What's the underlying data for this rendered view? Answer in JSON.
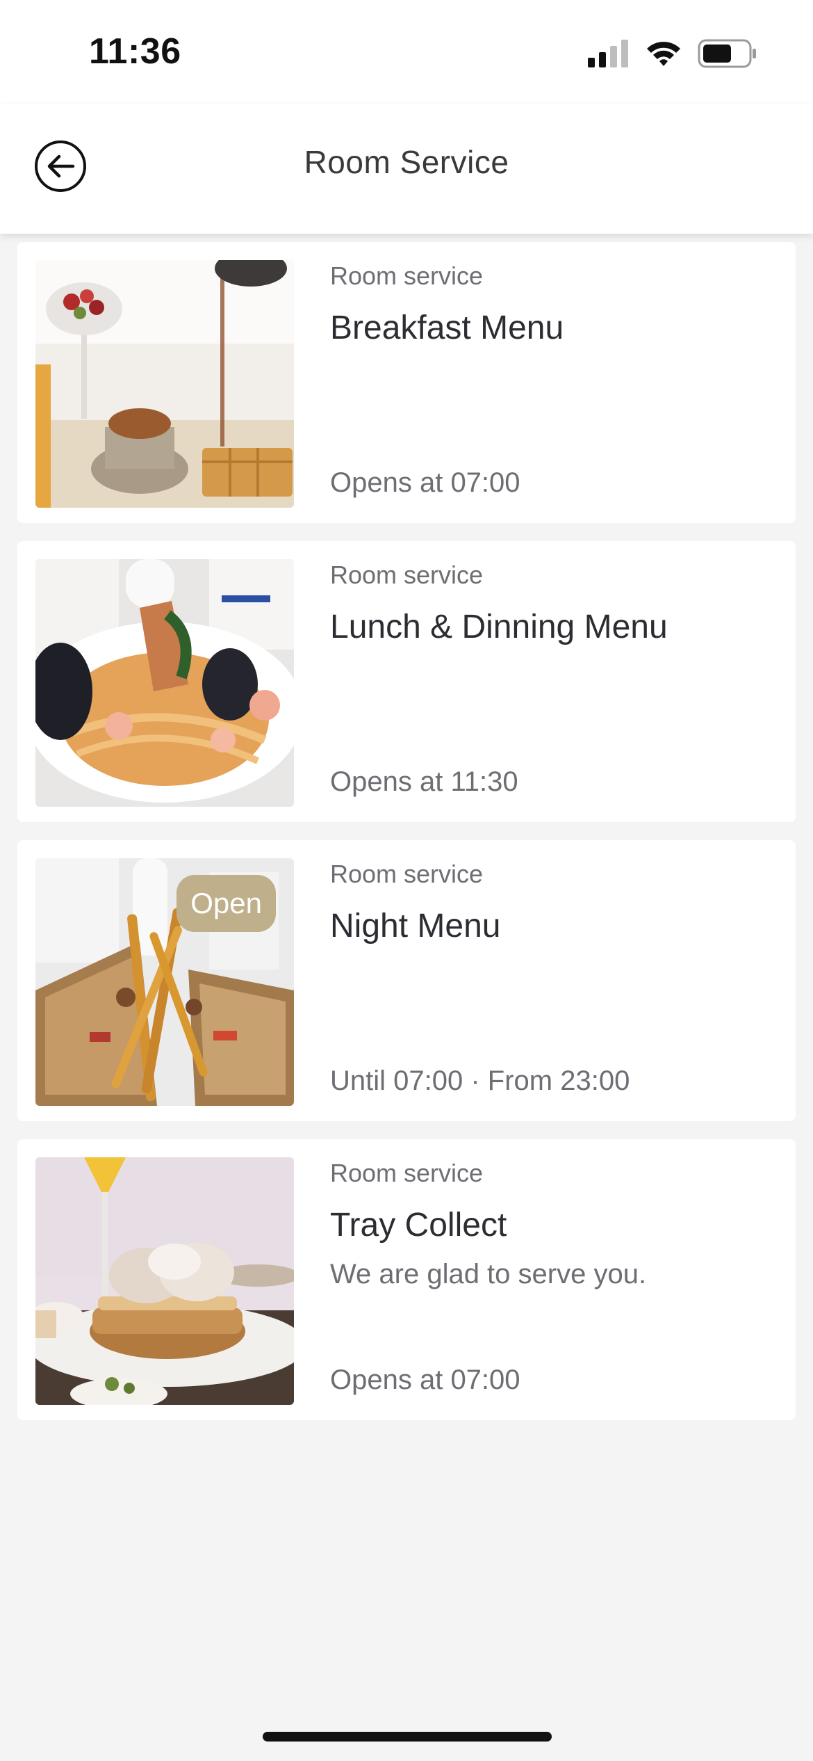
{
  "status_bar": {
    "time": "11:36",
    "icons": [
      "cellular-signal-icon",
      "wifi-icon",
      "battery-icon"
    ],
    "battery_level": 0.65
  },
  "header": {
    "back_icon": "arrow-left-circle-icon",
    "title": "Room Service"
  },
  "items": [
    {
      "category": "Room service",
      "title": "Breakfast Menu",
      "description": "",
      "hours": "Opens at 07:00",
      "badge": "",
      "image": "breakfast-waffle-photo"
    },
    {
      "category": "Room service",
      "title": "Lunch & Dinning Menu",
      "description": "",
      "hours": "Opens at 11:30",
      "badge": "",
      "image": "seafood-pasta-photo"
    },
    {
      "category": "Room service",
      "title": "Night Menu",
      "description": "",
      "hours": "Until 07:00 · From 23:00",
      "badge": "Open",
      "image": "club-sandwich-fries-photo"
    },
    {
      "category": "Room service",
      "title": "Tray Collect",
      "description": "We are glad to serve you.",
      "hours": "Opens at 07:00",
      "badge": "",
      "image": "pastry-sandwich-photo"
    }
  ],
  "colors": {
    "badge_bg": "#bfb08b",
    "page_bg": "#f4f4f4",
    "title_text": "#2c2c33",
    "secondary_text": "#6d6d74"
  }
}
